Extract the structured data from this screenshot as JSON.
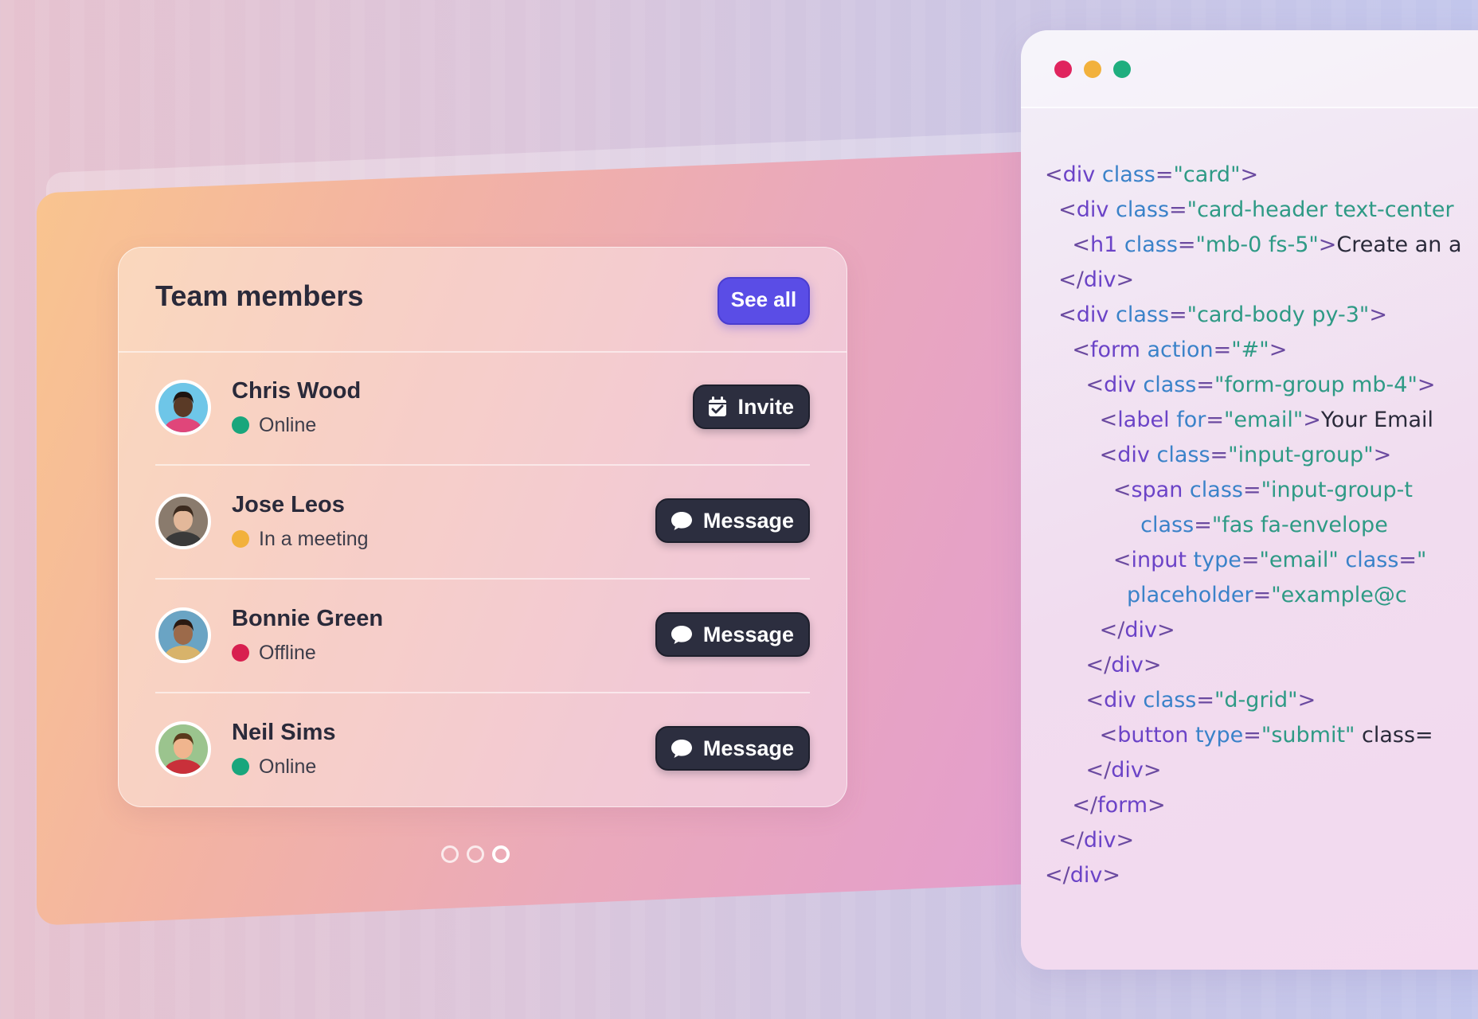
{
  "card": {
    "title": "Team members",
    "see_all_label": "See all"
  },
  "members": [
    {
      "name": "Chris Wood",
      "status": "Online",
      "status_color": "#19a67c",
      "action": "Invite",
      "action_icon": "calendar-check-icon"
    },
    {
      "name": "Jose Leos",
      "status": "In a meeting",
      "status_color": "#f2b13c",
      "action": "Message",
      "action_icon": "chat-bubble-icon"
    },
    {
      "name": "Bonnie Green",
      "status": "Offline",
      "status_color": "#d81f4f",
      "action": "Message",
      "action_icon": "chat-bubble-icon"
    },
    {
      "name": "Neil Sims",
      "status": "Online",
      "status_color": "#19a67c",
      "action": "Message",
      "action_icon": "chat-bubble-icon"
    }
  ],
  "carousel": {
    "count": 3,
    "active_index": 2
  },
  "code_window": {
    "traffic_lights": [
      "#e0245e",
      "#f2b13c",
      "#1fae7e"
    ],
    "lines": [
      "<div class=\"card\">",
      "  <div class=\"card-header text-center",
      "    <h1 class=\"mb-0 fs-5\">Create an a",
      "  </div>",
      "  <div class=\"card-body py-3\">",
      "    <form action=\"#\">",
      "      <div class=\"form-group mb-4\">",
      "        <label for=\"email\">Your Email",
      "        <div class=\"input-group\">",
      "          <span class=\"input-group-t",
      "              class=\"fas fa-envelope",
      "          <input type=\"email\" class=\"",
      "            placeholder=\"example@c",
      "        </div>",
      "      </div>",
      "      <div class=\"d-grid\">",
      "        <button type=\"submit\" class=",
      "      </div>",
      "    </form>",
      "  </div>",
      "</div>"
    ]
  }
}
